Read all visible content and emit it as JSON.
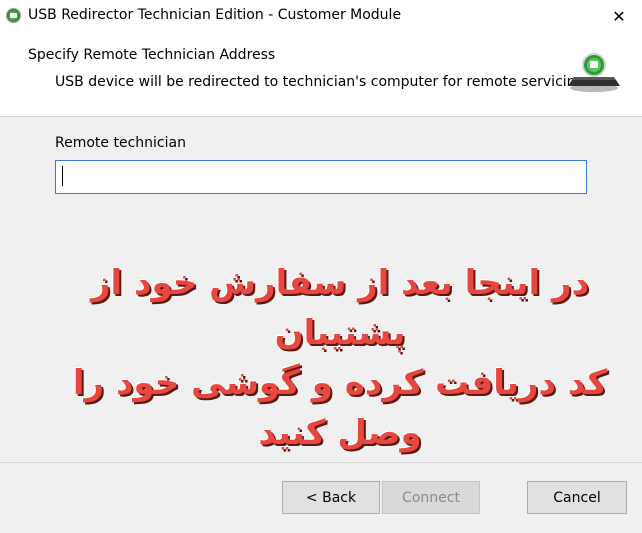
{
  "window": {
    "title": "USB Redirector Technician Edition - Customer Module",
    "close_glyph": "✕"
  },
  "header": {
    "title": "Specify Remote Technician Address",
    "subtitle": "USB device will be redirected to technician's computer for remote servicing."
  },
  "form": {
    "remote_technician_label": "Remote technician",
    "remote_technician_value": ""
  },
  "overlay": {
    "line1": "در اینجا بعد از سفارش خود از پشتیبان",
    "line2": "کد دریافت کرده و گوشی خود را",
    "line3": "وصل کنید",
    "color": "#e8473f"
  },
  "buttons": {
    "back_label": "< Back",
    "connect_label": "Connect",
    "cancel_label": "Cancel"
  },
  "icons": {
    "app": "usb-redirector-app-icon",
    "header": "usb-computer-icon"
  }
}
